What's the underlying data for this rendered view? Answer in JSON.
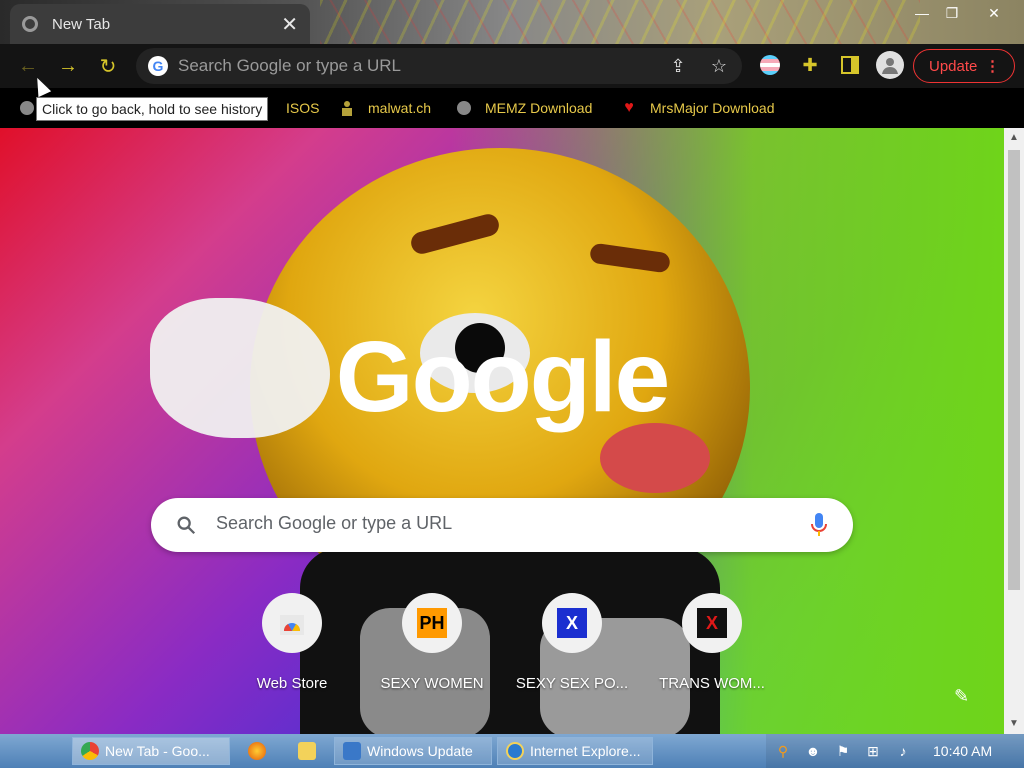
{
  "tab": {
    "title": "New Tab"
  },
  "toolbar": {
    "omnibox_placeholder": "Search Google or type a URL",
    "update_label": "Update"
  },
  "tooltip": "Click to go back, hold to see history",
  "bookmarks": [
    {
      "label": "ISOS",
      "icon": "globe-icon"
    },
    {
      "label": "malwat.ch",
      "icon": "figure-icon"
    },
    {
      "label": "MEMZ Download",
      "icon": "globe-icon"
    },
    {
      "label": "MrsMajor Download",
      "icon": "heart-icon"
    }
  ],
  "ntp": {
    "logo": "Google",
    "search_placeholder": "Search Google or type a URL",
    "shortcuts": [
      {
        "label": "Web Store",
        "tile_text": ""
      },
      {
        "label": "SEXY WOMEN",
        "tile_text": "PH"
      },
      {
        "label": "SEXY SEX PO...",
        "tile_text": "X"
      },
      {
        "label": "TRANS WOM...",
        "tile_text": "X"
      }
    ]
  },
  "taskbar": {
    "buttons": [
      {
        "label": "New Tab - Goo..."
      },
      {
        "label": "Windows Update"
      },
      {
        "label": "Internet Explore..."
      }
    ],
    "clock": "10:40 AM"
  },
  "colors": {
    "accent": "#d6c52a",
    "update": "#ff4a4a",
    "bookmark_text": "#e7c94a"
  }
}
